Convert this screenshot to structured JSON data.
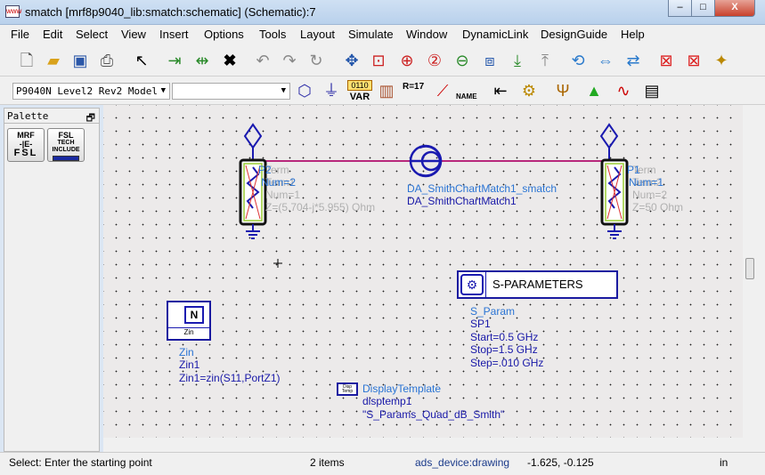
{
  "window": {
    "title": "smatch [mrf8p9040_lib:smatch:schematic] (Schematic):7",
    "icon": "ads-icon",
    "min": "–",
    "max": "□",
    "close": "X"
  },
  "menu": [
    "File",
    "Edit",
    "Select",
    "View",
    "Insert",
    "Options",
    "Tools",
    "Layout",
    "Simulate",
    "Window",
    "DynamicLink",
    "DesignGuide",
    "Help"
  ],
  "toolbar1": [
    "new-icon",
    "open-icon",
    "save-icon",
    "print-icon",
    "select-pointer-icon",
    "insert-pin-icon",
    "insert-wire-icon",
    "delete-icon",
    "undo-icon",
    "redo-icon",
    "rotate-icon",
    "move-icon",
    "zoom-area-icon",
    "zoom-in-icon",
    "zoom-2-icon",
    "zoom-out-icon",
    "component-icon",
    "push-icon",
    "pop-icon",
    "tune-icon",
    "align-icon",
    "mirror-icon",
    "deactivate-icon",
    "short-icon",
    "wizard-icon"
  ],
  "toolbar2": {
    "library_combo": "P9040N Level2 Rev2 Model",
    "component_combo": "",
    "var_label": "VAR",
    "var_top": "0110",
    "r_label": "R=17",
    "name_label": "NAME"
  },
  "palette": {
    "title": "Palette",
    "items": [
      {
        "top": "MRF",
        "bottom": "FSL"
      },
      {
        "top": "FSL",
        "mid": "TECH",
        "bottom": "INCLUDE"
      }
    ]
  },
  "schematic": {
    "term_left": {
      "name": "P2",
      "type": "Term",
      "inst": "Term1",
      "num_a": "Num=2",
      "num_b": "Num=1",
      "z": "Z=(5.704-j*5.955) Ohm"
    },
    "term_right": {
      "name": "P1",
      "type": "Term",
      "inst": "Term2",
      "num_a": "Num=1",
      "num_b": "Num=2",
      "z": "Z=50 Ohm"
    },
    "smith": {
      "type": "DA_SmithChartMatch1_smatch",
      "inst": "DA_SmithChartMatch1"
    },
    "sparam": {
      "title": "S-PARAMETERS",
      "type": "S_Param",
      "inst": "SP1",
      "start": "Start=0.5 GHz",
      "stop": "Stop=1.5 GHz",
      "step": "Step=.010 GHz"
    },
    "zin": {
      "icon_label": "N",
      "sub": "Zin",
      "type": "Zin",
      "inst": "Zin1",
      "expr": "Zin1=zin(S11,PortZ1)"
    },
    "display": {
      "icon_label": "Disp Temp",
      "type": "DisplayTemplate",
      "inst": "disptemp1",
      "value": "\"S_Params_Quad_dB_Smith\""
    }
  },
  "status": {
    "prompt": "Select: Enter the starting point",
    "items": "2 items",
    "layer": "ads_device:drawing",
    "coords": "-1.625, -0.125",
    "units": "in"
  }
}
